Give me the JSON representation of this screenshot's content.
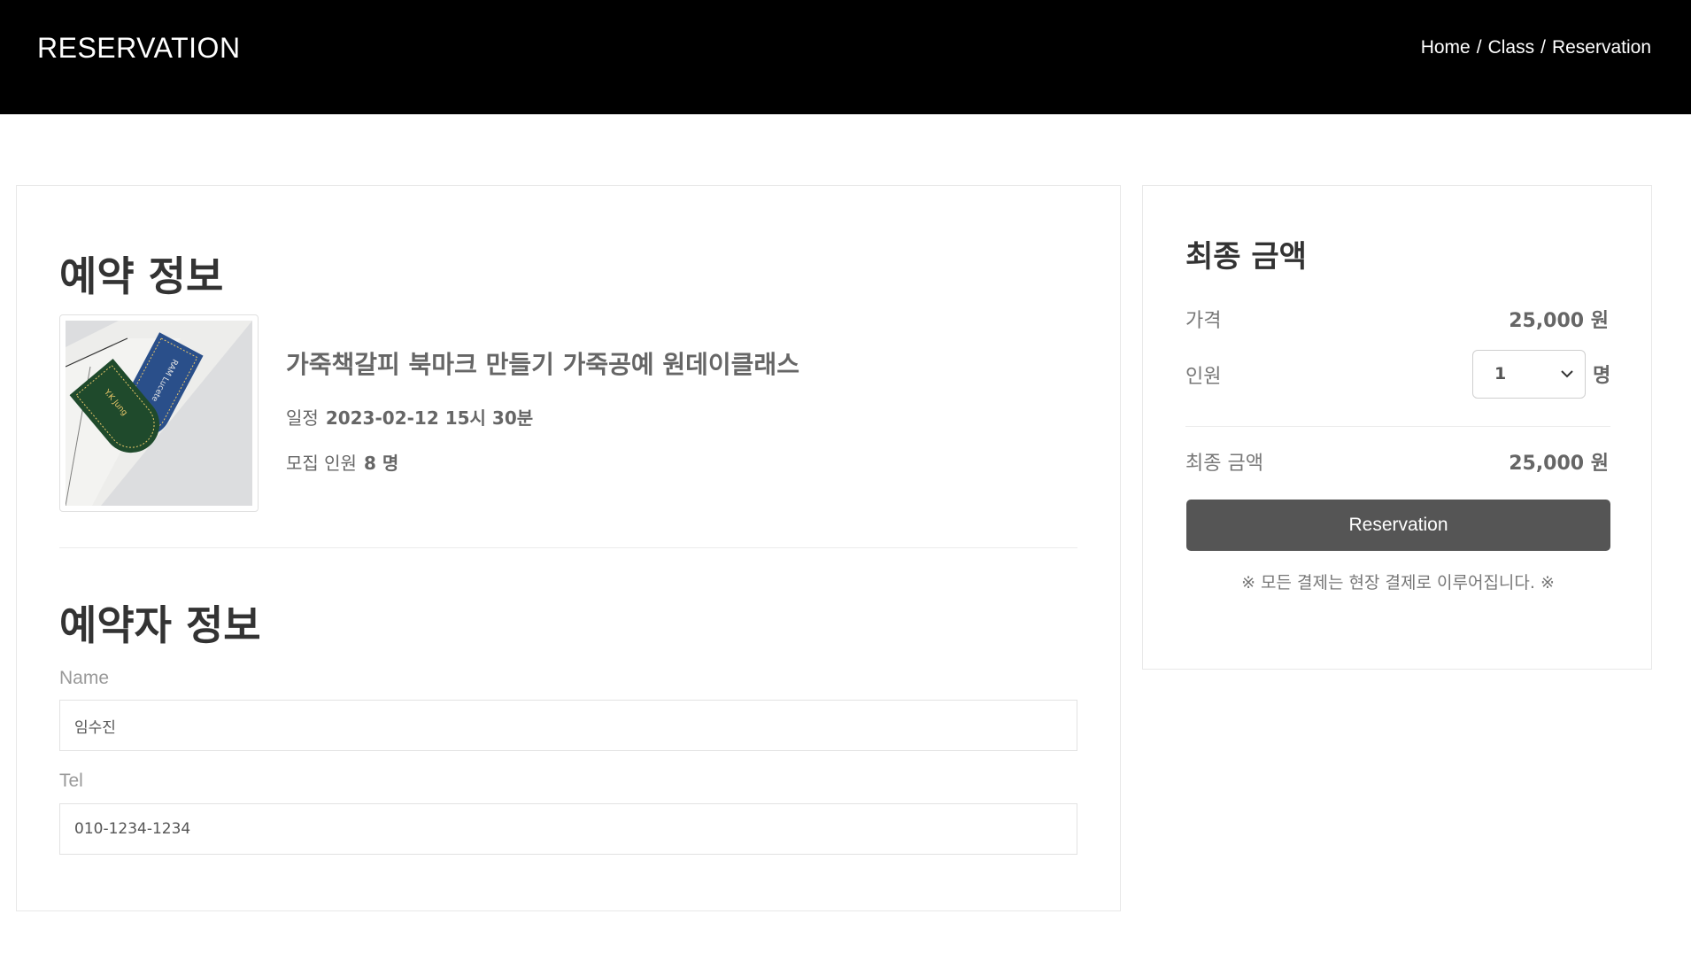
{
  "header": {
    "brand": "RESERVATION",
    "breadcrumb": [
      "Home",
      "Class",
      "Reservation"
    ],
    "separator": "/"
  },
  "booking": {
    "title": "예약 정보",
    "class_title": "가죽책갈피 북마크 만들기 가죽공예 원데이클래스",
    "schedule_label": "일정",
    "schedule_value": "2023-02-12 15시 30분",
    "capacity_label": "모집 인원",
    "capacity_value": "8 명",
    "image": {
      "bookmark_green_text": "Y.K Jung",
      "bookmark_blue_text": "RAM Lucete"
    }
  },
  "booker": {
    "title": "예약자 정보",
    "name_label": "Name",
    "name_value": "임수진",
    "tel_label": "Tel",
    "tel_value": "010-1234-1234"
  },
  "summary": {
    "title": "최종 금액",
    "price_label": "가격",
    "price_value": "25,000 원",
    "people_label": "인원",
    "people_selected": "1",
    "people_unit": "명",
    "total_label": "최종 금액",
    "total_value": "25,000 원",
    "button_label": "Reservation",
    "notice": "※ 모든 결제는 현장 결제로 이루어집니다. ※"
  },
  "colors": {
    "header_bg": "#000000",
    "button_bg": "#555555",
    "bookmark_green": "#1f4a2c",
    "bookmark_blue": "#2a4f8a"
  }
}
